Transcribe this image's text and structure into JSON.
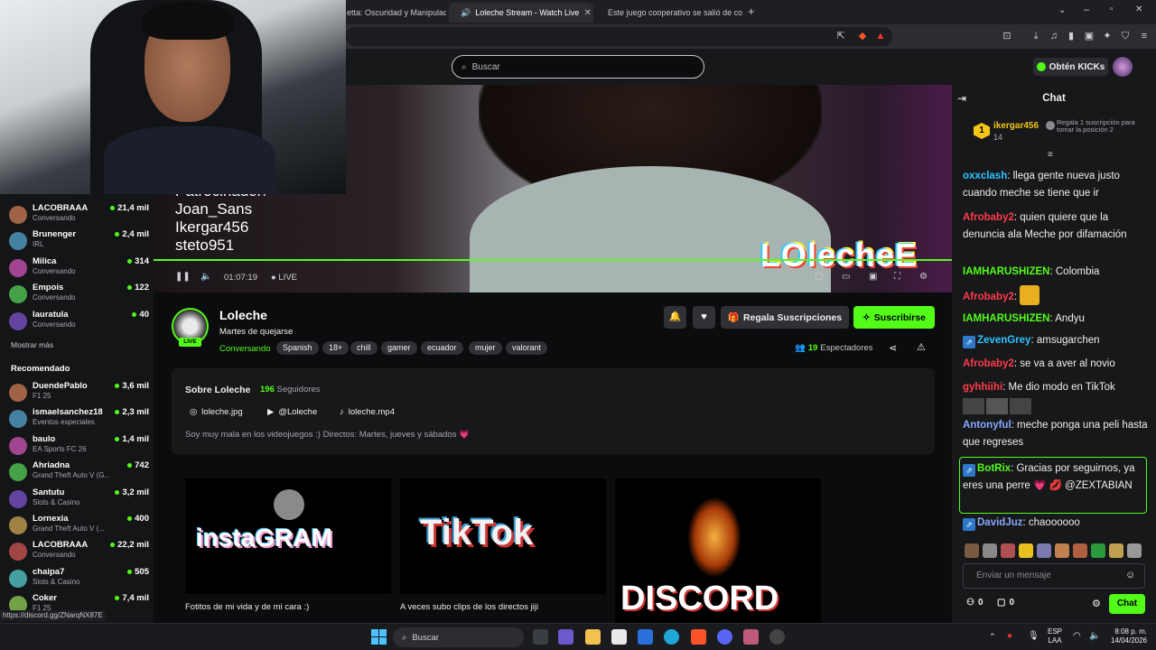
{
  "browser": {
    "tabs": [
      {
        "label": "etta: Oscuridad y Manipulació",
        "active": false
      },
      {
        "label": "Loleche Stream - Watch Live",
        "active": true
      },
      {
        "label": "Este juego cooperativo se salió de co",
        "active": false
      }
    ],
    "new_tab": "+"
  },
  "header": {
    "search_placeholder": "Buscar",
    "kicks_button": "Obtén KICKs"
  },
  "sidebar": {
    "following": [
      {
        "name": "LACOBRAAA",
        "sub": "Conversando",
        "count": "21,4 mil"
      },
      {
        "name": "Brunenger",
        "sub": "IRL",
        "count": "2,4 mil"
      },
      {
        "name": "Milica",
        "sub": "Conversando",
        "count": "314"
      },
      {
        "name": "Empois",
        "sub": "Conversando",
        "count": "122"
      },
      {
        "name": "lauratula",
        "sub": "Conversando",
        "count": "40"
      }
    ],
    "show_more": "Mostrar más",
    "recommended_title": "Recomendado",
    "recommended": [
      {
        "name": "DuendePablo",
        "sub": "F1 25",
        "count": "3,6 mil"
      },
      {
        "name": "ismaelsanchez18",
        "sub": "Eventos especiales",
        "count": "2,3 mil"
      },
      {
        "name": "baulo",
        "sub": "EA Sports FC 26",
        "count": "1,4 mil"
      },
      {
        "name": "Ahriadna",
        "sub": "Grand Theft Auto V (G...",
        "count": "742"
      },
      {
        "name": "Santutu",
        "sub": "Slots & Casino",
        "count": "3,2 mil"
      },
      {
        "name": "Lornexia",
        "sub": "Grand Theft Auto V (...",
        "count": "400"
      },
      {
        "name": "LACOBRAAA",
        "sub": "Conversando",
        "count": "22,2 mil"
      },
      {
        "name": "chaipa7",
        "sub": "Slots & Casino",
        "count": "505"
      },
      {
        "name": "Coker",
        "sub": "F1 25",
        "count": "7,4 mil"
      }
    ]
  },
  "player": {
    "overlay_text": "Patrocinador:\nJoan_Sans\nIkergar456\nsteto951",
    "overlay_logo": "LOlecheE",
    "time": "01:07:19",
    "live_label": "LIVE"
  },
  "channel": {
    "name": "Loleche",
    "live_badge": "LIVE",
    "title": "Martes de quejarse",
    "category": "Conversando",
    "tags": [
      "Spanish",
      "18+",
      "chill",
      "gamer",
      "ecuador",
      "mujer",
      "valorant"
    ],
    "gift_button": "Regala Suscripciones",
    "subscribe_button": "Suscribirse",
    "viewers_count": "19",
    "viewers_label": "Espectadores"
  },
  "about": {
    "title": "Sobre Loleche",
    "followers_count": "196",
    "followers_label": "Seguidores",
    "instagram": "loleche.jpg",
    "youtube": "@Loleche",
    "tiktok": "loleche.mp4",
    "description": "Soy muy mala en los videojuegos :) Directos: Martes, jueves y sábados 💗"
  },
  "panels": [
    {
      "art": "instaGRAM",
      "caption": "Fotitos de mi vida y de mi cara :)"
    },
    {
      "art": "TikTok",
      "caption": "A veces subo clips de los directos jiji"
    },
    {
      "art": "DISCORD",
      "caption": ""
    }
  ],
  "chat": {
    "title": "Chat",
    "pinned_user": "ikergar456",
    "pinned_rank": "1",
    "pinned_count": "14",
    "pinned_promo": "Regala 1 suscripción para tomar la posición 2",
    "messages": [
      {
        "user": "oxxclash",
        "text": "llega gente nueva justo cuando meche se tiene que ir",
        "color": "#2dc3ff"
      },
      {
        "user": "Afrobaby2",
        "text": "quien quiere que la denuncia ala Meche por difamación",
        "color": "#ff3b4a"
      },
      {
        "user": "IAMHARUSHIZEN",
        "text": "Colombia",
        "color": "#53fc18"
      },
      {
        "user": "Afrobaby2",
        "text": "",
        "color": "#ff3b4a"
      },
      {
        "user": "IAMHARUSHIZEN",
        "text": "Andyu",
        "color": "#53fc18"
      },
      {
        "user": "ZevenGrey",
        "text": "amsugarchen",
        "color": "#2dc3ff"
      },
      {
        "user": "Afrobaby2",
        "text": "se va a aver al novio",
        "color": "#ff3b4a"
      },
      {
        "user": "gyhhiihi",
        "text": "Me dio modo en TikTok",
        "color": "#ff3b4a"
      },
      {
        "user": "Antonyful",
        "text": "meche ponga una peli hasta que regreses",
        "color": "#8aa8ff"
      },
      {
        "user": "BotRix",
        "text": "Gracias por seguirnos, ya eres una perre 💗 💋 @ZEXTABIAN",
        "color": "#53fc18"
      },
      {
        "user": "DavidJuz",
        "text": "chaoooooo",
        "color": "#8aa8ff"
      }
    ],
    "input_placeholder": "Enviar un mensaje",
    "stat1": "0",
    "stat2": "0",
    "send_button": "Chat"
  },
  "status_url": "https://discord.gg/ZNarqNX87E",
  "taskbar": {
    "search": "Buscar",
    "lang1": "ESP",
    "lang2": "LAA",
    "time": "8:08 p. m.",
    "date": "14/04/2026"
  },
  "colors": {
    "accent": "#53fc18",
    "bg": "#0b0c0d",
    "panel": "#17181a"
  }
}
